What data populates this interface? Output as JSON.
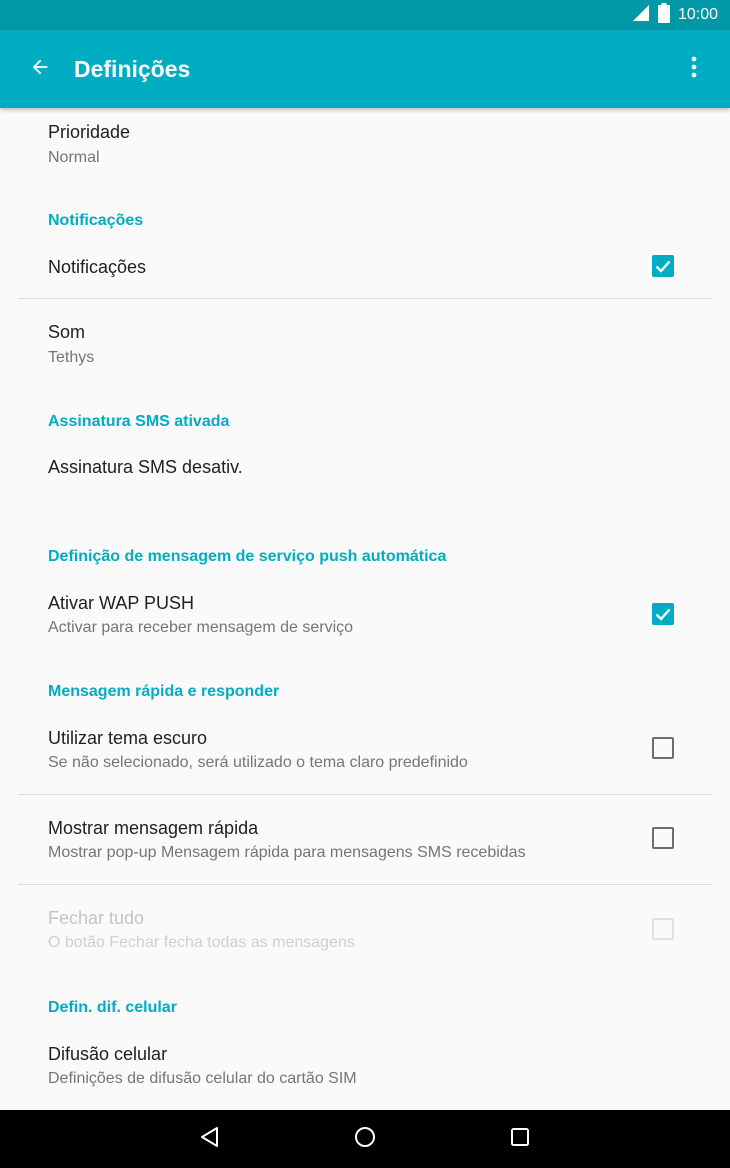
{
  "status_bar": {
    "time": "10:00",
    "icons": [
      "signal-icon",
      "battery-icon"
    ]
  },
  "app_bar": {
    "title": "Definições",
    "back_icon": "arrow-left-icon",
    "menu_icon": "more-vert-icon"
  },
  "colors": {
    "accent": "#00acc1",
    "status_bar": "#0097a7",
    "text_primary": "#212121",
    "text_secondary": "#757575"
  },
  "prefs": {
    "priority": {
      "title": "Prioridade",
      "summary": "Normal"
    },
    "cat_notifications": "Notificações",
    "notifications": {
      "title": "Notificações",
      "checked": true
    },
    "sound": {
      "title": "Som",
      "summary": "Tethys"
    },
    "cat_sms_signature": "Assinatura SMS ativada",
    "sms_signature": {
      "title": "Assinatura SMS desativ."
    },
    "cat_push": "Definição de mensagem de serviço push automática",
    "wap_push": {
      "title": "Ativar WAP PUSH",
      "summary": "Activar para receber mensagem de serviço",
      "checked": true
    },
    "cat_quick_message": "Mensagem rápida e responder",
    "dark_theme": {
      "title": "Utilizar tema escuro",
      "summary": "Se não selecionado, será utilizado o tema claro predefinido",
      "checked": false
    },
    "quick_message": {
      "title": "Mostrar mensagem rápida",
      "summary": "Mostrar pop-up Mensagem rápida para mensagens SMS recebidas",
      "checked": false
    },
    "close_all": {
      "title": "Fechar tudo",
      "summary": "O botão Fechar fecha todas as mensagens",
      "checked": false,
      "enabled": false
    },
    "cat_cell_broadcast": "Defin. dif. celular",
    "cell_broadcast": {
      "title": "Difusão celular",
      "summary": "Definições de difusão celular do cartão SIM"
    }
  },
  "nav_bar": {
    "buttons": [
      "back-triangle-icon",
      "home-circle-icon",
      "recents-square-icon"
    ]
  }
}
